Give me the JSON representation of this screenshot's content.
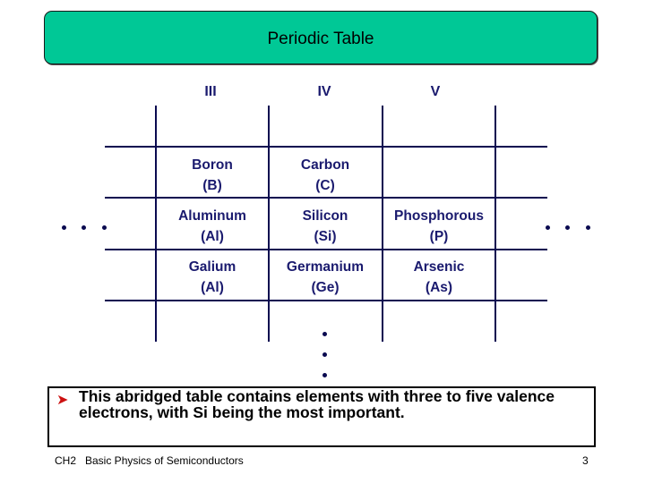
{
  "slide": {
    "title": "Periodic Table",
    "group_headers": [
      "III",
      "IV",
      "V"
    ],
    "rows": [
      {
        "cells": [
          {
            "name": "Boron",
            "symbol": "(B)"
          },
          {
            "name": "Carbon",
            "symbol": "(C)"
          },
          {
            "name": "",
            "symbol": ""
          }
        ]
      },
      {
        "cells": [
          {
            "name": "Aluminum",
            "symbol": "(Al)"
          },
          {
            "name": "Silicon",
            "symbol": "(Si)"
          },
          {
            "name": "Phosphorous",
            "symbol": "(P)"
          }
        ]
      },
      {
        "cells": [
          {
            "name": "Galium",
            "symbol": "(Al)"
          },
          {
            "name": "Germanium",
            "symbol": "(Ge)"
          },
          {
            "name": "Arsenic",
            "symbol": "(As)"
          }
        ]
      }
    ],
    "ellipsis_icons": [
      "ellipsis-left-icon",
      "ellipsis-right-icon",
      "ellipsis-down-icon"
    ],
    "bullet": {
      "icon": "arrow-bullet-icon",
      "glyph": "➤",
      "text": "This abridged table contains elements with three to five valence electrons, with Si being the most important."
    },
    "footer": {
      "chapter": "CH2   Basic Physics of Semiconductors",
      "page_number": "3"
    },
    "colors": {
      "title_bg": "#00c896",
      "table_text": "#1a1a6e",
      "grid_lines": "#0a0a50",
      "bullet_arrow": "#cc1111"
    }
  }
}
